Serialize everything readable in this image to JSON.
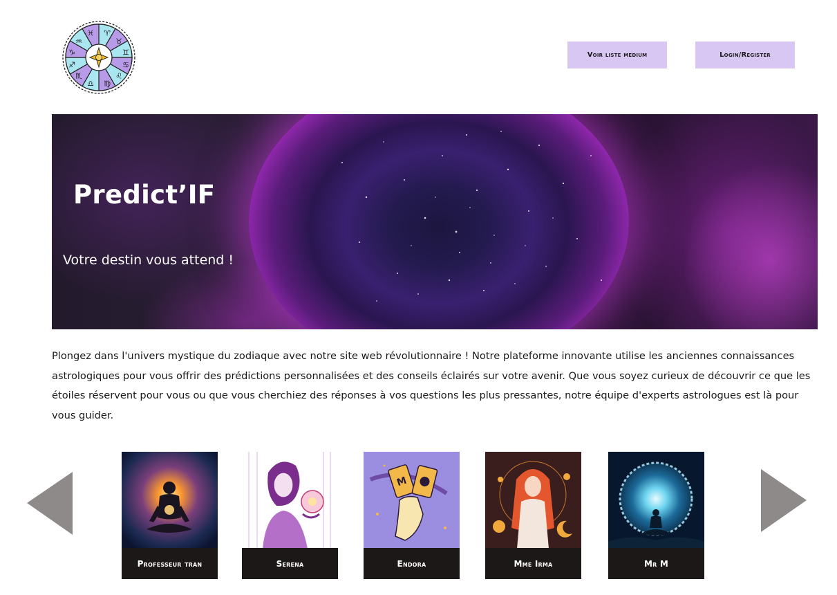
{
  "header": {
    "nav": {
      "mediums_label": "Voir liste medium",
      "login_label": "Login/Register"
    }
  },
  "hero": {
    "title": "Predict’IF",
    "subtitle": "Votre destin vous attend !"
  },
  "intro": {
    "text": "Plongez dans l'univers mystique du zodiaque avec notre site web  révolutionnaire ! Notre plateforme innovante utilise les anciennes connaissances astrologiques pour vous offrir des prédictions  personnalisées et des conseils éclairés sur votre avenir. Que vous soyez curieux de découvrir ce que les étoiles réservent pour vous ou que vous  cherchiez des réponses à vos questions les plus pressantes, notre équipe d'experts astrologues est là pour vous guider."
  },
  "carousel": {
    "mediums": [
      {
        "name": "Professeur tran",
        "icon": "meditating-man-icon"
      },
      {
        "name": "Serena",
        "icon": "crystal-ball-woman-icon"
      },
      {
        "name": "Endora",
        "icon": "tarot-cards-icon"
      },
      {
        "name": "Mme Irma",
        "icon": "celestial-woman-icon"
      },
      {
        "name": "Mr M",
        "icon": "meditation-portal-icon"
      }
    ]
  },
  "colors": {
    "nav_button_bg": "#d9c7f3",
    "card_label_bg": "#1c1818",
    "arrow": "#8e8a8a",
    "accent_magenta": "#d43ee6"
  }
}
